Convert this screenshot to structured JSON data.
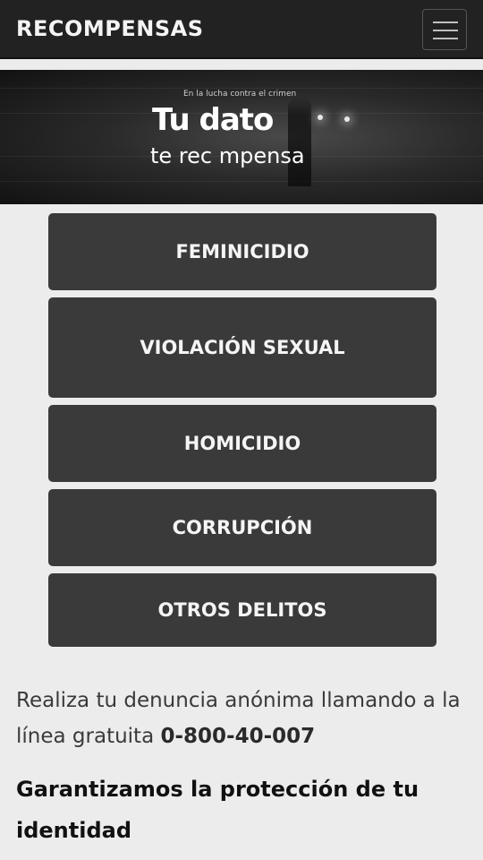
{
  "header": {
    "title": "RECOMPENSAS",
    "menu_icon": "hamburger-menu-icon"
  },
  "banner": {
    "kicker": "En la lucha contra el crimen",
    "title": "Tu dato",
    "subtitle": "te rec  mpensa"
  },
  "categories": [
    {
      "label": "FEMINICIDIO"
    },
    {
      "label": "VIOLACIÓN SEXUAL"
    },
    {
      "label": "HOMICIDIO"
    },
    {
      "label": "CORRUPCIÓN"
    },
    {
      "label": "OTROS DELITOS"
    }
  ],
  "info": {
    "text": "Realiza tu denuncia anónima llamando a la línea gratuita ",
    "phone": "0-800-40-007",
    "guarantee": "Garantizamos la protección de tu identidad"
  },
  "colors": {
    "topbar": "#222222",
    "button": "#3a3a3a",
    "background": "#ececec"
  }
}
